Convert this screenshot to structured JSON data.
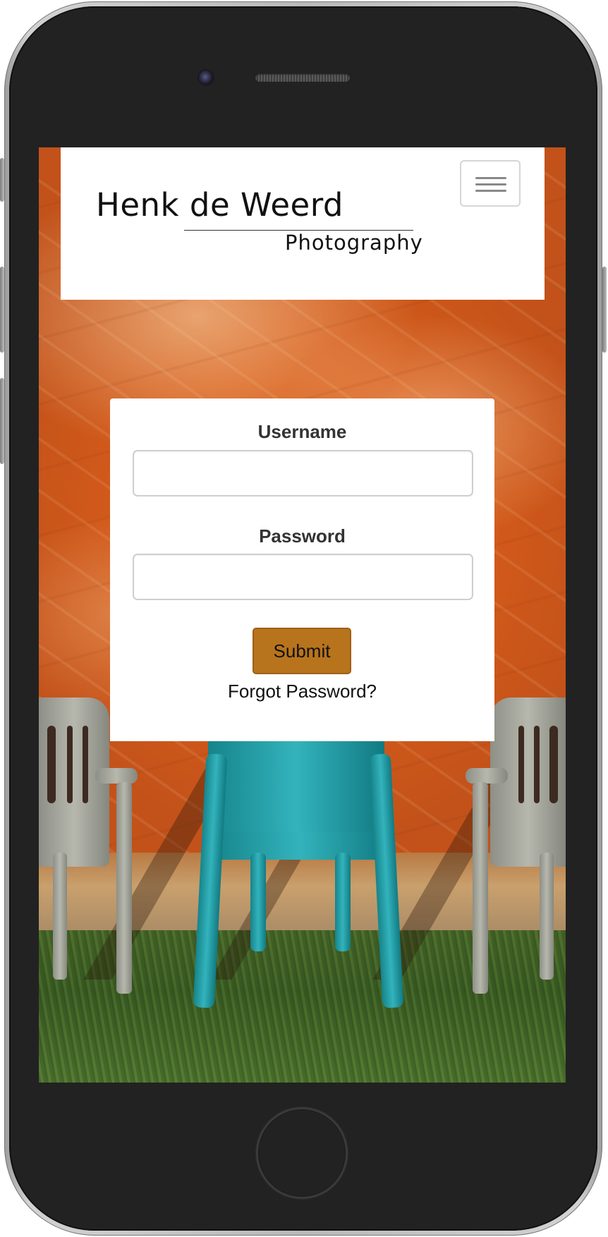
{
  "header": {
    "brand_name": "Henk de Weerd",
    "brand_subtitle": "Photography",
    "menu_icon": "hamburger-menu-icon"
  },
  "login_form": {
    "username_label": "Username",
    "username_value": "",
    "password_label": "Password",
    "password_value": "",
    "submit_label": "Submit",
    "forgot_password_label": "Forgot Password?"
  },
  "background": {
    "subject": "three plastic chairs against an orange wall on grass"
  },
  "colors": {
    "accent_button": "#b8741c",
    "card_background": "#ffffff",
    "wall_orange": "#d45a1a"
  }
}
